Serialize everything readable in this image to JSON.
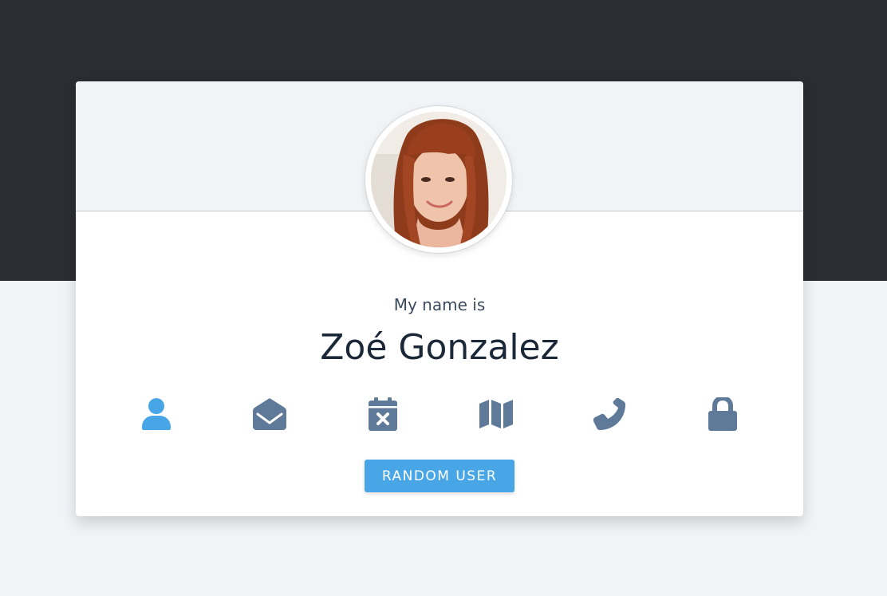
{
  "profile": {
    "label": "My name is",
    "value": "Zoé Gonzalez"
  },
  "icons": [
    {
      "name": "user-icon",
      "active": true
    },
    {
      "name": "envelope-open-icon",
      "active": false
    },
    {
      "name": "calendar-times-icon",
      "active": false
    },
    {
      "name": "map-icon",
      "active": false
    },
    {
      "name": "phone-icon",
      "active": false
    },
    {
      "name": "lock-icon",
      "active": false
    }
  ],
  "button": {
    "label": "RANDOM USER"
  },
  "colors": {
    "dark_band": "#2c2d32",
    "page_background": "#f0f4f7",
    "accent": "#48a6e7",
    "icon_inactive": "#5f7a99",
    "name_text": "#1b2838"
  }
}
